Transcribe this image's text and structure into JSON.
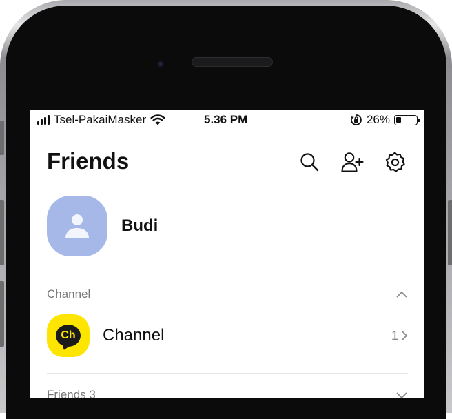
{
  "status_bar": {
    "carrier": "Tsel-PakaiMasker",
    "time": "5.36 PM",
    "battery": "26%",
    "battery_level": 0.26
  },
  "header": {
    "title": "Friends",
    "icons": [
      "search-icon",
      "add-friend-icon",
      "settings-icon"
    ]
  },
  "profile": {
    "name": "Budi",
    "avatar_color": "#a6b8e8"
  },
  "channel_section": {
    "title": "Channel",
    "expanded": true,
    "item": {
      "logo_text": "Ch",
      "name": "Channel",
      "count": "1",
      "logo_color": "#fee500"
    }
  },
  "friends_section": {
    "title": "Friends 3",
    "expanded": false
  }
}
